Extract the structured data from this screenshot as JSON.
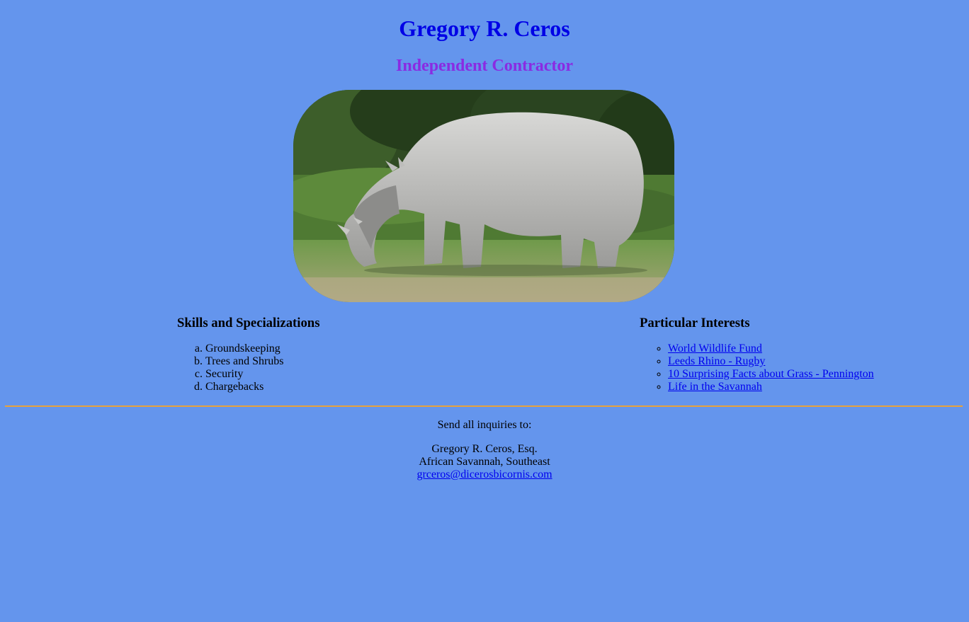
{
  "header": {
    "name": "Gregory R. Ceros",
    "subtitle": "Independent Contractor"
  },
  "photo": {
    "subject": "rhinoceros-grazing"
  },
  "skills": {
    "heading": "Skills and Specializations",
    "items": [
      "Groundskeeping",
      "Trees and Shrubs",
      "Security",
      "Chargebacks"
    ]
  },
  "interests": {
    "heading": "Particular Interests",
    "links": [
      "World Wildlife Fund",
      "Leeds Rhino - Rugby",
      "10 Surprising Facts about Grass - Pennington",
      "Life in the Savannah"
    ]
  },
  "footer": {
    "intro": "Send all inquiries to:",
    "name": "Gregory R. Ceros, Esq.",
    "location": "African Savannah, Southeast",
    "email": "grceros@dicerosbicornis.com"
  },
  "colors": {
    "background": "#6495ED",
    "title": "#0000E6",
    "subtitle": "#8A2BE2",
    "link": "#0000EE",
    "rule": "#E6A23C"
  }
}
